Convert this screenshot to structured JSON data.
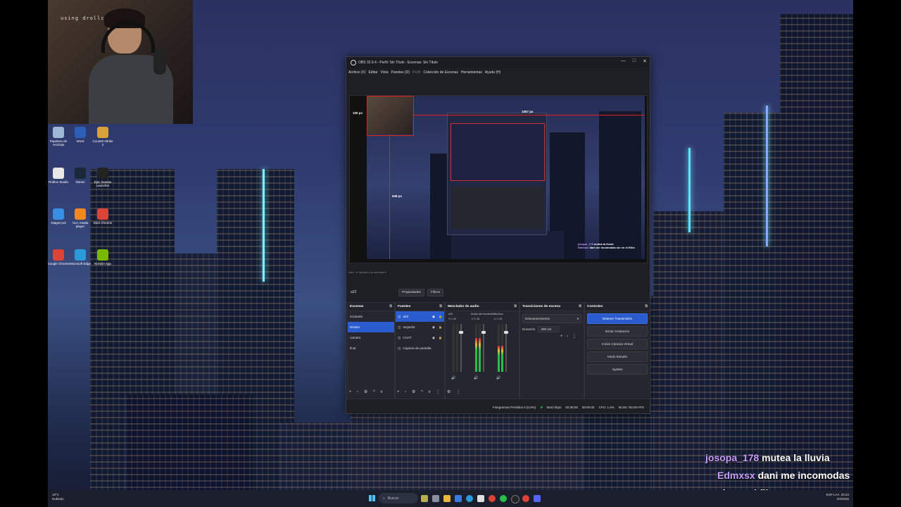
{
  "webcam": {
    "overlay_text": "using drollcam.app"
  },
  "desktop_icons": [
    {
      "label": "Papelera de reciclaje",
      "color": "#9fb8d8"
    },
    {
      "label": "Word",
      "color": "#2b5fb8"
    },
    {
      "label": "Counter-Strike 2",
      "color": "#d8a13a"
    },
    {
      "label": "Roblox Studio",
      "color": "#e8e8e8"
    },
    {
      "label": "Steam",
      "color": "#1b2838"
    },
    {
      "label": "Epic Games Launcher",
      "color": "#222"
    },
    {
      "label": "DiagnCool",
      "color": "#3a8de0"
    },
    {
      "label": "VLC media player",
      "color": "#f08a1c"
    },
    {
      "label": "Dani Chrome",
      "color": "#db4437"
    },
    {
      "label": "Google Chrome",
      "color": "#db4437"
    },
    {
      "label": "Microsoft Edge",
      "color": "#2a9ad8"
    },
    {
      "label": "NVIDIA App",
      "color": "#76b900"
    }
  ],
  "obs": {
    "title": "OBS 32.0.4 - Perfil: Sin Título - Escenas: Sin Título",
    "window_controls": [
      "—",
      "□",
      "✕"
    ],
    "menu": [
      "Archivo (F)",
      "Editar",
      "Vista",
      "Paneles (D)",
      "Perfil",
      "Colección de Escenas",
      "Herramientas",
      "Ayuda (H)"
    ],
    "menu_disabled_index": 4,
    "preview": {
      "label_top": "1067 px",
      "label_left": "100 px",
      "label_mid": "548 px",
      "chat_lines": [
        {
          "user": "josopa_178",
          "msg": "mutea la lluvia"
        },
        {
          "user": "Edmxsx",
          "msg": "dani me incomodas sin en el filtro"
        }
      ]
    },
    "source_row": {
      "left": "cmb",
      "mid": "Ajustar a la ventana"
    },
    "selected_source": "a23",
    "prop_buttons": [
      "Propiedades",
      "Filtros"
    ],
    "docks": {
      "scenes": {
        "title": "Escenas",
        "items": [
          "iniciando",
          "stream",
          "camara",
          "final"
        ],
        "selected": 1
      },
      "sources": {
        "title": "Fuentes",
        "items": [
          "a23",
          "seguidor",
          "CHAT",
          "Captura de pantalla"
        ],
        "selected": 0
      },
      "mixer": {
        "title": "Mezclador de audio",
        "channels": [
          {
            "name": "a23",
            "db": "0.0 dB",
            "level": 0.0
          },
          {
            "name": "Audio del escritorio",
            "db": "-0.5 dB",
            "level": 0.7
          },
          {
            "name": "Mic/Aux",
            "db": "-4.3 dB",
            "level": 0.55
          }
        ]
      },
      "transitions": {
        "title": "Transiciones de escena",
        "type": "Desvanecimiento",
        "duration_label": "Duración",
        "duration_value": "300 ms"
      },
      "controls": {
        "title": "Controles",
        "buttons": [
          "Detener Transmisión",
          "Iniciar Grabación",
          "Iniciar Cámara Virtual",
          "Modo Estudio",
          "Ajustes"
        ]
      }
    },
    "status": {
      "frames_dropped": "Fotogramas Perdidos 0 (0,0%)",
      "bitrate": "6642 kbps",
      "stream_time": "00:38:06",
      "rec_time": "00:00:00",
      "cpu": "CPU: 1.5%",
      "fps": "60,00 / 60,00 FPS"
    }
  },
  "chat": [
    {
      "user": "josopa_178",
      "msg": "mutea la lluvia"
    },
    {
      "user": "Edmxsx",
      "msg": "dani me incomodas sin en el filtro"
    }
  ],
  "taskbar": {
    "weather_temp": "19°C",
    "weather_desc": "Nublado",
    "search_placeholder": "Buscar",
    "time": "20:23",
    "date": "4/3/2026",
    "lang": "ESP LAA"
  },
  "colors": {
    "accent": "#2b5ccf",
    "red_guides": "#e02020",
    "chat_user": "#c99cff"
  }
}
